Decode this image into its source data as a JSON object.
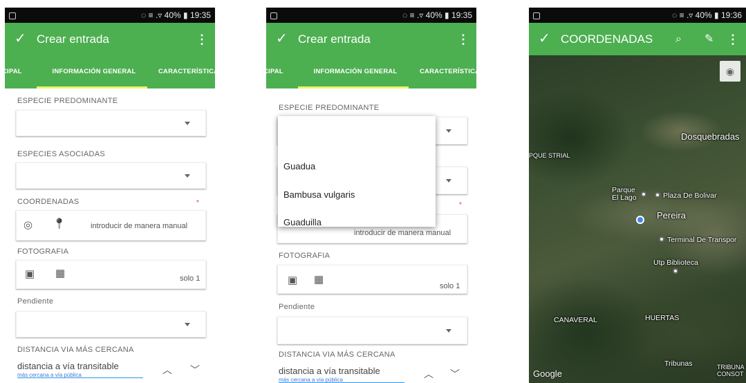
{
  "status": {
    "left_icon": "screenshot-icon",
    "signal": "◌ ≡ .▿ 40% ▮",
    "time": "19:35",
    "time_map": "19:36"
  },
  "appbar": {
    "title": "Crear entrada",
    "map_title": "COORDENADAS"
  },
  "tabs": {
    "left": "CIPAL",
    "active": "INFORMACIÓN GENERAL",
    "right": "CARACTERÍSTICA"
  },
  "fields": {
    "especie_predominante": "ESPECIE PREDOMINANTE",
    "especies_asociadas": "ESPECIES ASOCIADAS",
    "coordenadas": "COORDENADAS",
    "required_mark": "*",
    "manual_entry": "introducir de manera manual",
    "fotografia": "FOTOGRAFIA",
    "solo": "solo 1",
    "pendiente": "Pendiente",
    "distancia": "DISTANCIA VIA MÁS CERCANA",
    "distancia_value": "distancia a vía transitable",
    "distancia_sub": "más cercana a vía pública"
  },
  "dropdown": {
    "options": [
      "Guadua",
      "Bambusa vulgaris",
      "Guaduilla"
    ]
  },
  "map": {
    "labels": {
      "dosquebradas": "Dosquebradas",
      "parque_lago": "Parque El Lago",
      "plaza_bolivar": "Plaza De Bolivar",
      "pereira": "Pereira",
      "terminal": "Terminal De Transpor",
      "utp": "Utp Biblioteca",
      "canaveral": "CANAVERAL",
      "huertas": "HUERTAS",
      "tribunas": "Tribunas",
      "tribunas_right": "TRIBUNA CONSOT",
      "left_edge": "PQUE STRIAL",
      "google": "Google"
    }
  }
}
